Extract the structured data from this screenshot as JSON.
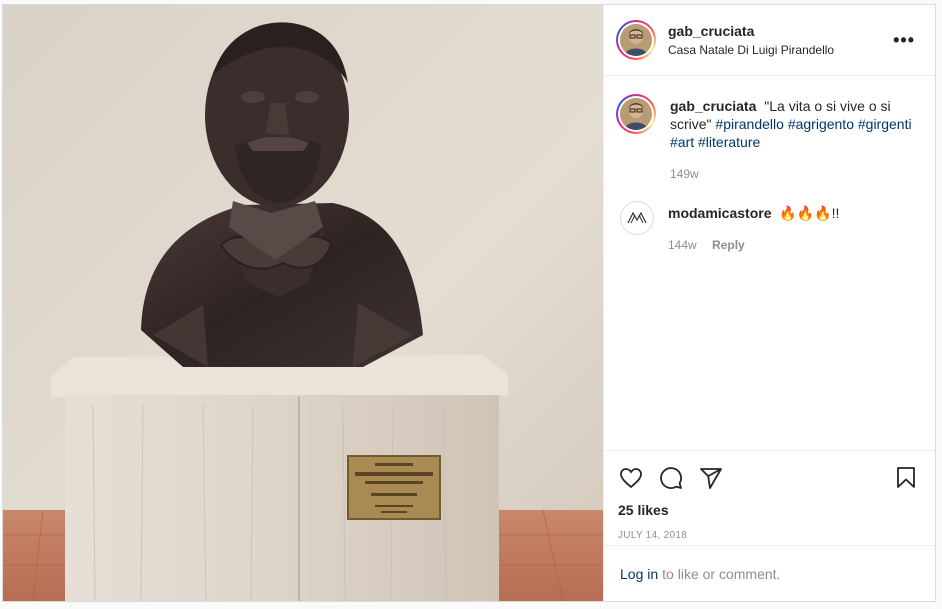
{
  "post": {
    "username": "gab_cruciata",
    "location": "Casa Natale Di Luigi Pirandello",
    "more_icon": "ellipsis-icon"
  },
  "caption": {
    "username": "gab_cruciata",
    "text": "\"La vita o si vive o si scrive\"",
    "hashtags": [
      "#pirandello",
      "#agrigento",
      "#girgenti",
      "#art",
      "#literature"
    ],
    "time": "149w"
  },
  "comments": [
    {
      "username": "modamicastore",
      "text": "🔥🔥🔥!!",
      "time": "144w",
      "reply_label": "Reply"
    }
  ],
  "actions": {
    "like_icon": "heart-icon",
    "comment_icon": "comment-icon",
    "share_icon": "share-icon",
    "save_icon": "bookmark-icon"
  },
  "likes": "25 likes",
  "date": "JULY 14, 2018",
  "login": {
    "link_label": "Log in",
    "suffix": "to like or comment."
  },
  "colors": {
    "link": "#00376b",
    "muted": "#8e8e8e",
    "border": "#dbdbdb"
  }
}
